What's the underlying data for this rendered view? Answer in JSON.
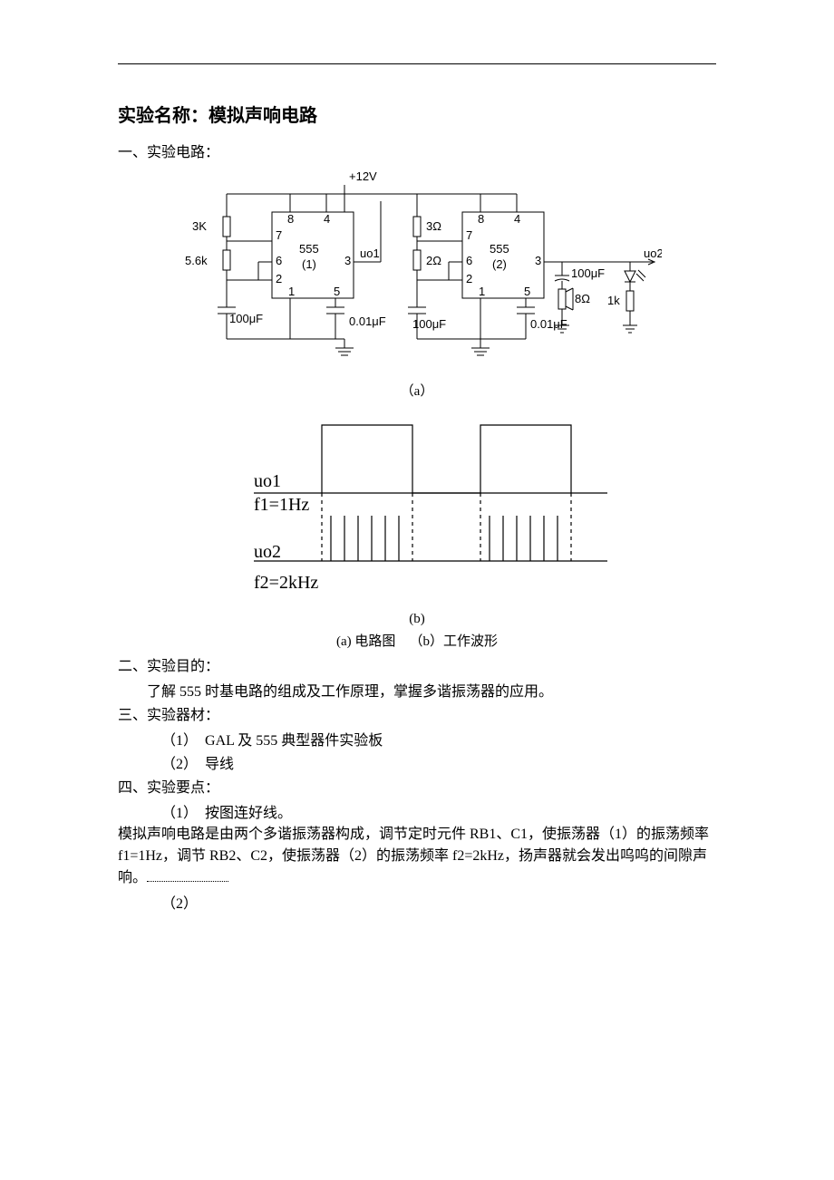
{
  "title_prefix": "实验名称：",
  "title_name": "模拟声响电路",
  "sec1": {
    "head": "一、实验电路："
  },
  "circuit": {
    "vcc": "+12V",
    "r1a": "3K",
    "r1b": "5.6k",
    "c1a": "100μF",
    "c1b": "0.01μF",
    "chip1_label": "555",
    "chip1_sub": "(1)",
    "uo1": "uo1",
    "r2a": "3Ω",
    "r2b": "2Ω",
    "c2a": "100μF",
    "c2b": "0.01μF",
    "chip2_label": "555",
    "chip2_sub": "(2)",
    "uo2": "uo2",
    "c_out": "100μF",
    "speaker": "8Ω",
    "r_led": "1k",
    "pins": {
      "p1": "1",
      "p2": "2",
      "p3": "3",
      "p4": "4",
      "p5": "5",
      "p6": "6",
      "p7": "7",
      "p8": "8"
    }
  },
  "fig_a_label": "（a）",
  "waveform": {
    "uo1_label": "uo1",
    "f1_label": "f1=1Hz",
    "uo2_label": "uo2",
    "f2_label": "f2=2kHz"
  },
  "fig_b_label": "(b)",
  "fig_caption_a": "(a) 电路图",
  "fig_caption_b": "（b）工作波形",
  "sec2": {
    "head": "二、实验目的：",
    "body": "了解 555 时基电路的组成及工作原理，掌握多谐振荡器的应用。"
  },
  "sec3": {
    "head": "三、实验器材：",
    "item1_num": "（1）",
    "item1_text": "GAL 及 555 典型器件实验板",
    "item2_num": "（2）",
    "item2_text": "导线"
  },
  "sec4": {
    "head": "四、实验要点：",
    "item1_num": "（1）",
    "item1_text": "按图连好线。",
    "para": "模拟声响电路是由两个多谐振荡器构成，调节定时元件 RB1、C1，使振荡器（1）的振荡频率 f1=1Hz，调节 RB2、C2，使振荡器（2）的振荡频率 f2=2kHz，扬声器就会发出呜呜的间隙声响。",
    "item2_num": "（2）"
  }
}
